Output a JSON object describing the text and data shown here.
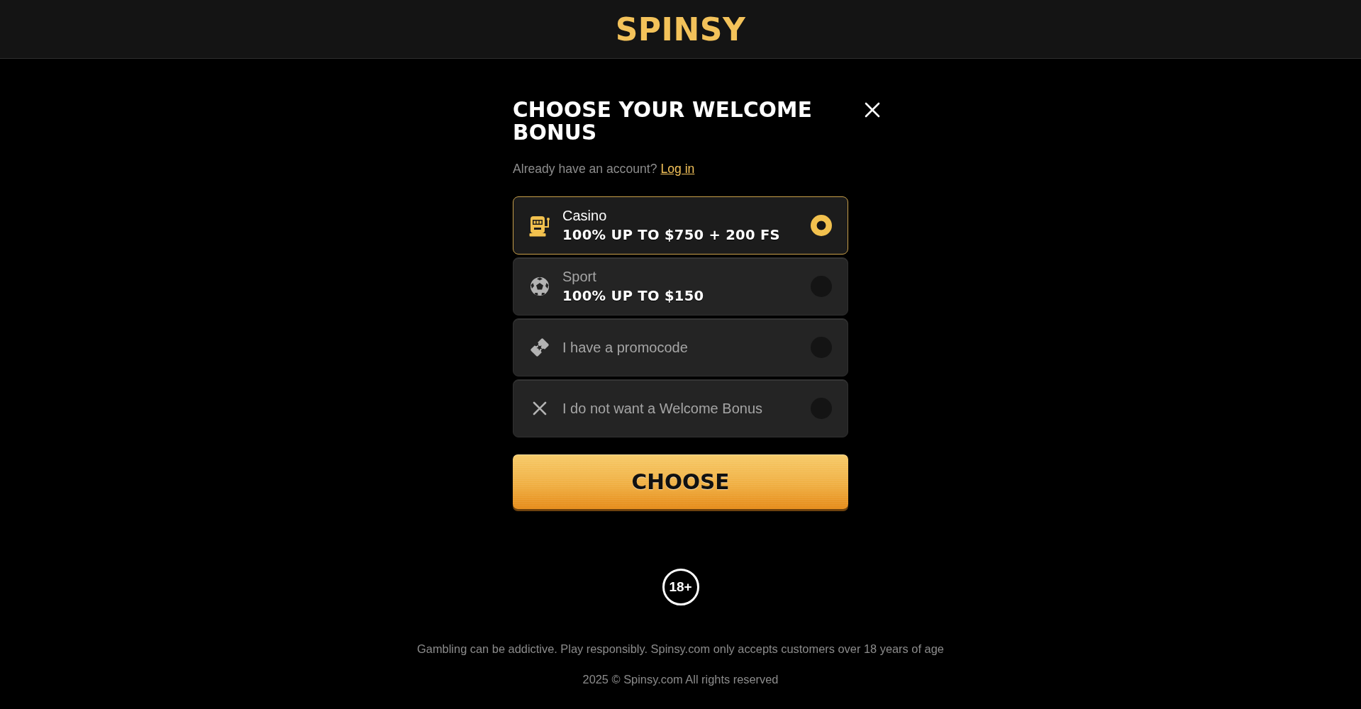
{
  "header": {
    "logo": "SPINSY"
  },
  "modal": {
    "title": "CHOOSE YOUR WELCOME BONUS",
    "login_prompt": {
      "text": "Already have an account?",
      "link": "Log in"
    },
    "options": [
      {
        "kind": "casino",
        "title": "Casino",
        "subtitle": "100% UP TO $750 + 200 FS",
        "selected": true
      },
      {
        "kind": "sport",
        "title": "Sport",
        "subtitle": "100% UP TO $150",
        "selected": false
      },
      {
        "kind": "promocode",
        "title": "I have a promocode",
        "selected": false
      },
      {
        "kind": "no_bonus",
        "title": "I do not want a Welcome Bonus",
        "selected": false
      }
    ],
    "submit_button": "CHOOSE"
  },
  "age_badge": "18+",
  "footer": {
    "disclaimer": "Gambling can be addictive. Play responsibly. Spinsy.com only accepts customers over 18 years of age",
    "copyright": "2025 © Spinsy.com All rights reserved"
  }
}
